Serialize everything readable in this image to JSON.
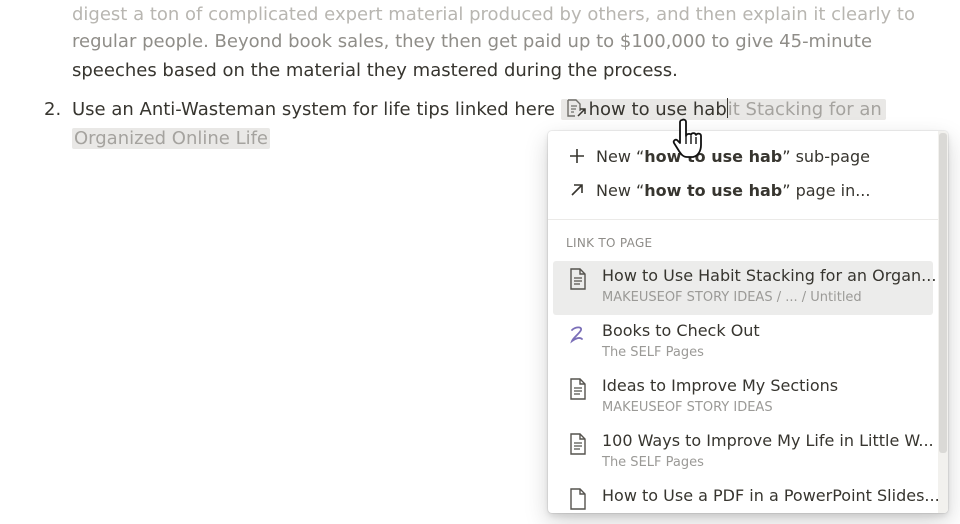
{
  "document": {
    "lines": [
      "digest a ton of complicated expert material produced by others, and then explain it clearly to",
      "regular people. Beyond book sales, they then get paid up to $100,000 to give 45-minute",
      "speeches based on the material they mastered during the process."
    ],
    "list_number": "2.",
    "list_text": "Use an Anti-Wasteman system for life tips linked here",
    "link_typed": "how to use hab",
    "link_ghost": "it Stacking for an",
    "link_ghost_line2": "Organized Online Life"
  },
  "menu": {
    "new_subpage": {
      "prefix": "New “",
      "query": "how to use hab",
      "suffix": "” sub-page",
      "icon": "plus-icon"
    },
    "new_page_in": {
      "prefix": "New “",
      "query": "how to use hab",
      "suffix": "” page in...",
      "icon": "arrow-up-right-icon"
    },
    "section_label": "LINK TO PAGE",
    "pages": [
      {
        "title": "How to Use Habit Stacking for an Organ...",
        "subtitle": "MAKEUSEOF STORY IDEAS / ... / Untitled",
        "icon": "page-text-icon",
        "active": true
      },
      {
        "title": "Books to Check Out",
        "subtitle": "The SELF Pages",
        "icon": "scribble-icon",
        "active": false
      },
      {
        "title": "Ideas to Improve My Sections",
        "subtitle": "MAKEUSEOF STORY IDEAS",
        "icon": "page-text-icon",
        "active": false
      },
      {
        "title": "100 Ways to Improve My Life in Little W...",
        "subtitle": "The SELF Pages",
        "icon": "page-text-icon",
        "active": false
      },
      {
        "title": "How to Use a PDF in a PowerPoint Slides...",
        "subtitle": "",
        "icon": "page-blank-icon",
        "active": false
      }
    ]
  },
  "colors": {
    "accent_scribble": "#7b6fb8",
    "text": "#37352f",
    "muted": "#9b9a97"
  }
}
